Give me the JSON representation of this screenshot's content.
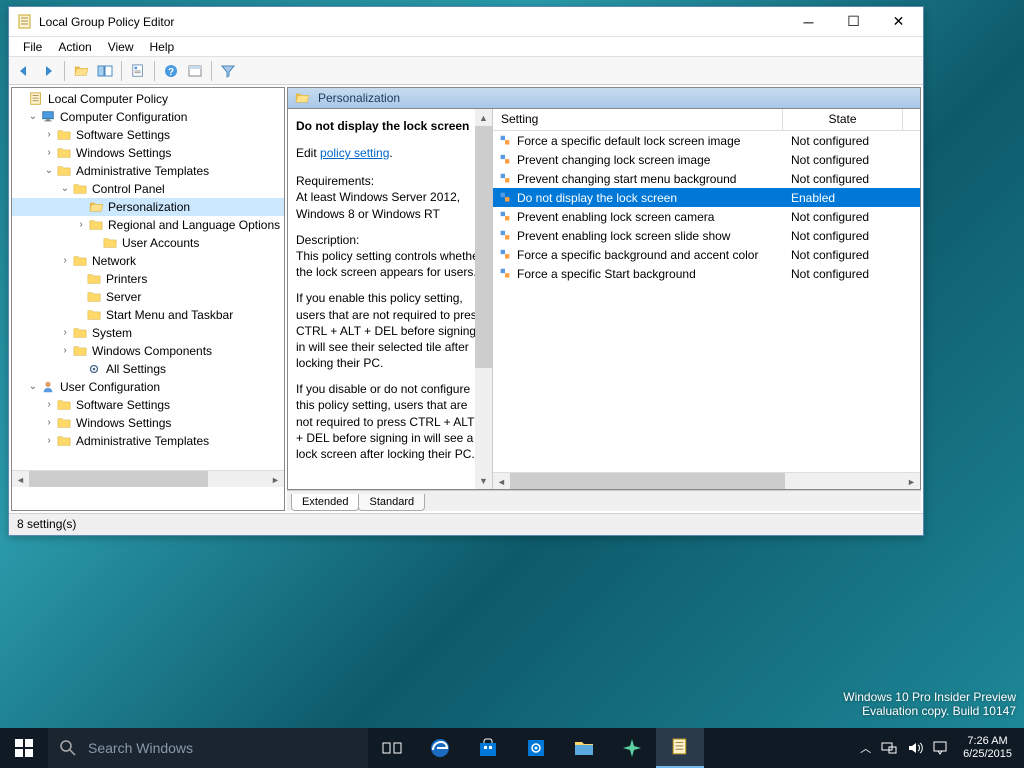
{
  "window": {
    "title": "Local Group Policy Editor",
    "menus": [
      "File",
      "Action",
      "View",
      "Help"
    ]
  },
  "tree": {
    "root": "Local Computer Policy",
    "cc": "Computer Configuration",
    "cc_children": [
      "Software Settings",
      "Windows Settings",
      "Administrative Templates"
    ],
    "cp": "Control Panel",
    "cp_children": [
      "Personalization",
      "Regional and Language Options",
      "User Accounts"
    ],
    "at_rest": [
      "Network",
      "Printers",
      "Server",
      "Start Menu and Taskbar",
      "System",
      "Windows Components",
      "All Settings"
    ],
    "uc": "User Configuration",
    "uc_children": [
      "Software Settings",
      "Windows Settings",
      "Administrative Templates"
    ]
  },
  "crumb": "Personalization",
  "desc": {
    "title": "Do not display the lock screen",
    "edit_prefix": "Edit",
    "edit_link": "policy setting",
    "req_label": "Requirements:",
    "req_text": "At least Windows Server 2012, Windows 8 or Windows RT",
    "d_label": "Description:",
    "d1": "This policy setting controls whether the lock screen appears for users.",
    "d2": "If you enable this policy setting, users that are not required to press CTRL + ALT + DEL before signing in will see their selected tile after locking their PC.",
    "d3": "If you disable or do not configure this policy setting, users that are not required to press CTRL + ALT + DEL before signing in will see a lock screen after locking their PC."
  },
  "list": {
    "headers": [
      "Setting",
      "State"
    ],
    "rows": [
      {
        "name": "Force a specific default lock screen image",
        "state": "Not configured",
        "sel": false
      },
      {
        "name": "Prevent changing lock screen image",
        "state": "Not configured",
        "sel": false
      },
      {
        "name": "Prevent changing start menu background",
        "state": "Not configured",
        "sel": false
      },
      {
        "name": "Do not display the lock screen",
        "state": "Enabled",
        "sel": true
      },
      {
        "name": "Prevent enabling lock screen camera",
        "state": "Not configured",
        "sel": false
      },
      {
        "name": "Prevent enabling lock screen slide show",
        "state": "Not configured",
        "sel": false
      },
      {
        "name": "Force a specific background and accent color",
        "state": "Not configured",
        "sel": false
      },
      {
        "name": "Force a specific Start background",
        "state": "Not configured",
        "sel": false
      }
    ]
  },
  "tabs": [
    "Extended",
    "Standard"
  ],
  "status": "8 setting(s)",
  "desktop": {
    "l1": "Windows 10 Pro Insider Preview",
    "l2": "Evaluation copy. Build 10147"
  },
  "taskbar": {
    "search_placeholder": "Search Windows",
    "time": "7:26 AM",
    "date": "6/25/2015"
  }
}
